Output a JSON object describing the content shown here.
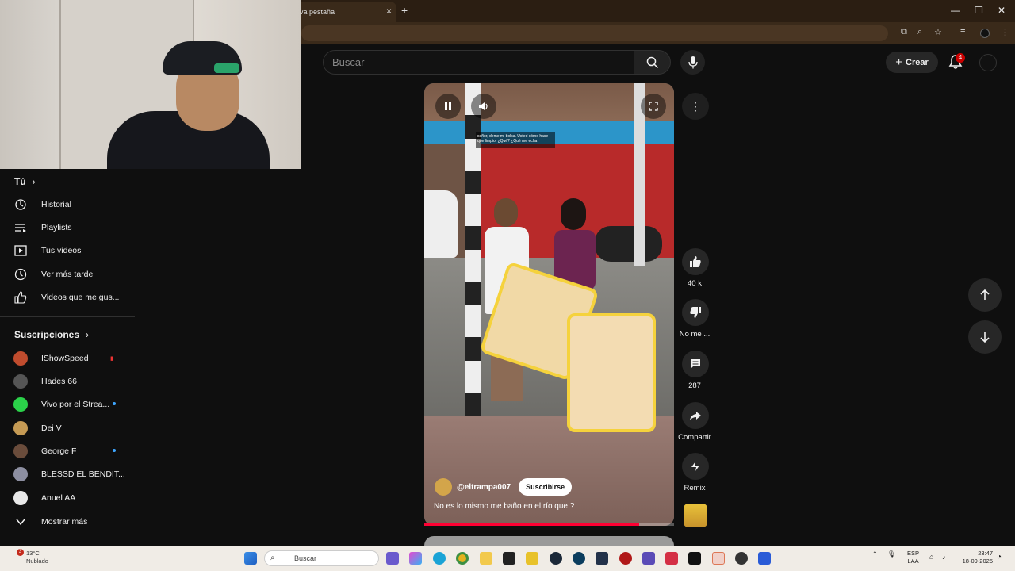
{
  "browser": {
    "tab_title": "va pestaña",
    "tab_close": "×",
    "new_tab": "+",
    "window_min": "—",
    "window_max": "❐",
    "window_close": "✕"
  },
  "header": {
    "search_placeholder": "Buscar",
    "create_label": "Crear",
    "notifications_count": "4"
  },
  "sidebar": {
    "you_label": "Tú",
    "you_items": [
      {
        "label": "Historial",
        "icon": "history-icon"
      },
      {
        "label": "Playlists",
        "icon": "playlist-icon"
      },
      {
        "label": "Tus videos",
        "icon": "video-icon"
      },
      {
        "label": "Ver más tarde",
        "icon": "clock-icon"
      },
      {
        "label": "Videos que me gus...",
        "icon": "thumbs-up-icon"
      }
    ],
    "subs_label": "Suscripciones",
    "subscriptions": [
      {
        "name": "IShowSpeed",
        "color": "#c04c2e",
        "live": false
      },
      {
        "name": "Hades 66",
        "color": "#555555",
        "live": false
      },
      {
        "name": "Vivo por el Strea...",
        "color": "#2bd24a",
        "live": true
      },
      {
        "name": "Dei V",
        "color": "#c59a54",
        "live": false
      },
      {
        "name": "George F",
        "color": "#6a4c3b",
        "live": true
      },
      {
        "name": "BLESSD EL BENDIT...",
        "color": "#8d8fa1",
        "live": false
      },
      {
        "name": "Anuel AA",
        "color": "#e8e8e8",
        "live": false
      }
    ],
    "show_more": "Mostrar más"
  },
  "short": {
    "overlay_caption": "señor, deme mi bolsa. Usted cómo hace que limpio. ¿Qué? ¿Qué me echa",
    "channel": "@eltrampa007",
    "subscribe_label": "Suscribirse",
    "title": "No es lo mismo me baño en el río que ?",
    "progress": 0.86
  },
  "actions": {
    "likes": "40 k",
    "dislike_label": "No me ...",
    "comments": "287",
    "share_label": "Compartir",
    "remix_label": "Remix"
  },
  "taskbar": {
    "weather_temp": "13°C",
    "weather_desc": "Nublado",
    "weather_badge": "3",
    "search_label": "Buscar",
    "lang_top": "ESP",
    "lang_bottom": "LAA",
    "time": "23:47",
    "date": "18-09-2025"
  },
  "colors": {
    "accent_red": "#ff0033",
    "live_dot": "#3ea6ff",
    "badge_red": "#cc0000"
  }
}
